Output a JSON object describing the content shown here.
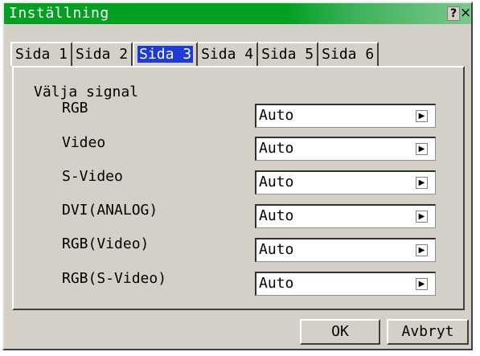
{
  "window": {
    "title": "Inställning",
    "help_label": "?",
    "close_label": "×"
  },
  "tabs": [
    {
      "label": "Sida 1"
    },
    {
      "label": "Sida 2"
    },
    {
      "label": "Sida 3"
    },
    {
      "label": "Sida 4"
    },
    {
      "label": "Sida 5"
    },
    {
      "label": "Sida 6"
    }
  ],
  "active_tab": "Sida 3",
  "section": {
    "title": "Välja signal"
  },
  "signals": [
    {
      "label": "RGB",
      "value": "Auto"
    },
    {
      "label": "Video",
      "value": "Auto"
    },
    {
      "label": "S-Video",
      "value": "Auto"
    },
    {
      "label": "DVI(ANALOG)",
      "value": "Auto"
    },
    {
      "label": "RGB(Video)",
      "value": "Auto"
    },
    {
      "label": "RGB(S-Video)",
      "value": "Auto"
    }
  ],
  "buttons": {
    "ok": "OK",
    "cancel": "Avbryt"
  },
  "colors": {
    "titlebar": "#00a020",
    "dialog_bg": "#d4d0c8",
    "active_tab": "#1e3ad8"
  }
}
